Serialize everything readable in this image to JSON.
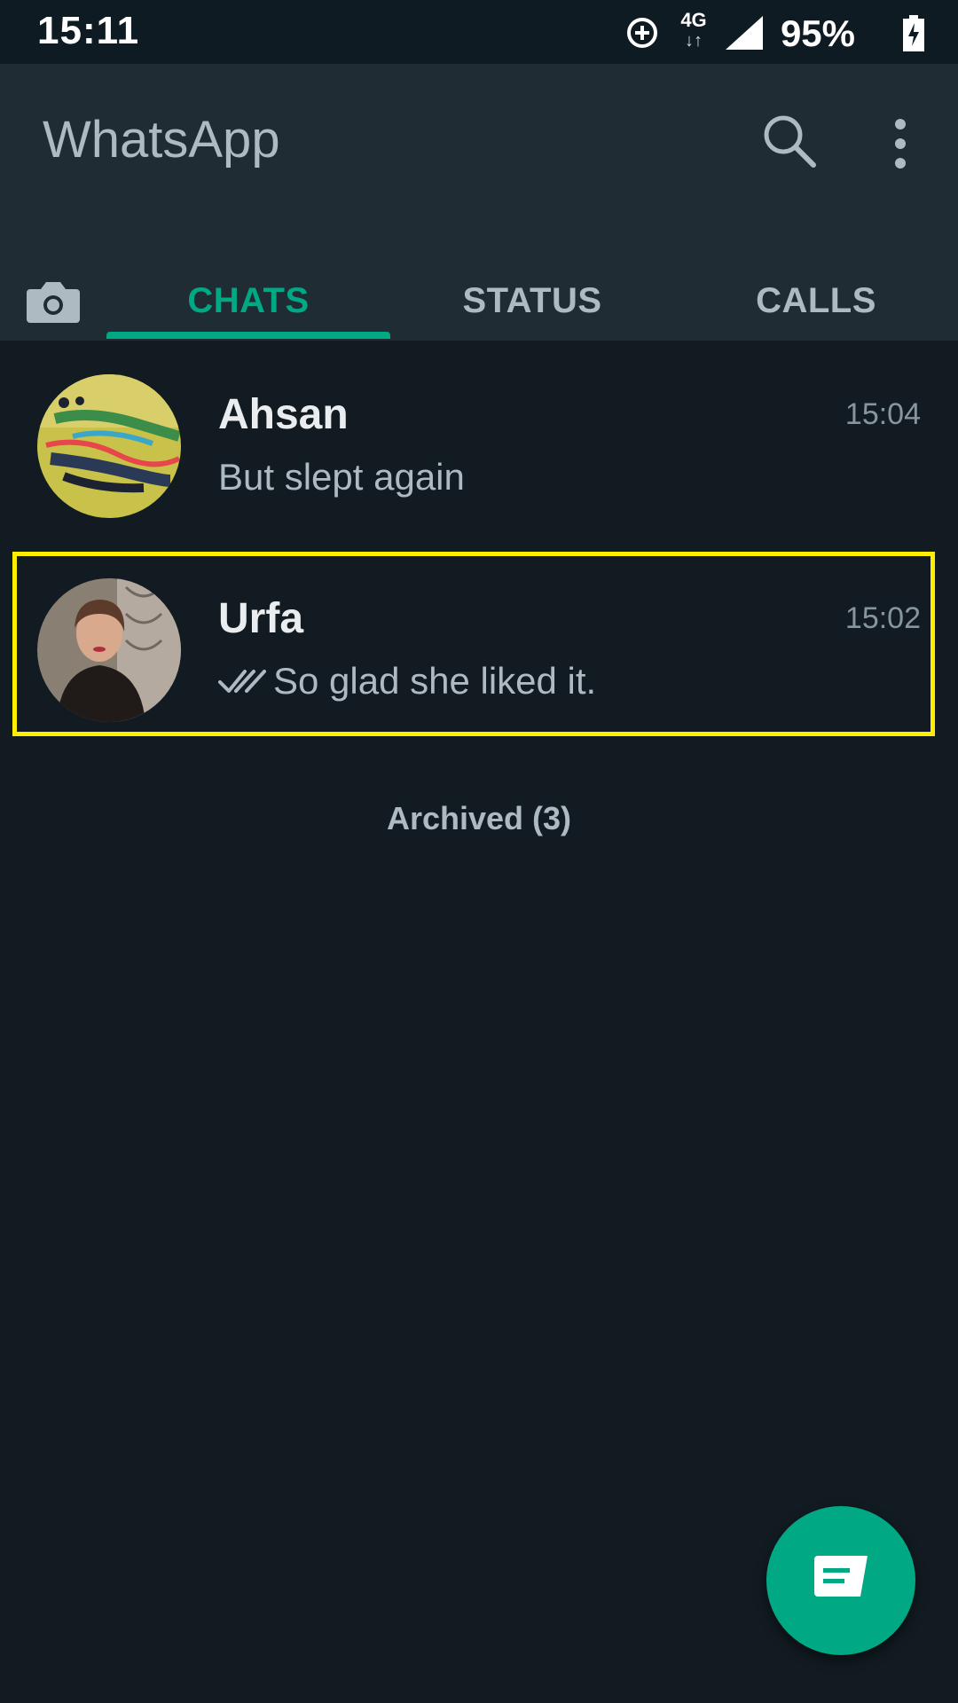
{
  "status_bar": {
    "time": "15:11",
    "network": "4G",
    "battery": "95%"
  },
  "app_bar": {
    "title": "WhatsApp",
    "tabs": [
      {
        "label": "CHATS",
        "selected": true
      },
      {
        "label": "STATUS",
        "selected": false
      },
      {
        "label": "CALLS",
        "selected": false
      }
    ]
  },
  "chats": [
    {
      "name": "Ahsan",
      "time": "15:04",
      "preview": "But slept again",
      "read_ticks": false
    },
    {
      "name": "Urfa",
      "time": "15:02",
      "preview": "So glad she liked it.",
      "read_ticks": true
    }
  ],
  "archived_label": "Archived (3)",
  "colors": {
    "accent": "#00a884",
    "background": "#111b21",
    "header": "#202c33",
    "highlight": "#ffee00"
  },
  "icons": {
    "search": "search-icon",
    "menu": "more-vert-icon",
    "camera": "camera-icon",
    "fab": "new-chat-icon"
  }
}
